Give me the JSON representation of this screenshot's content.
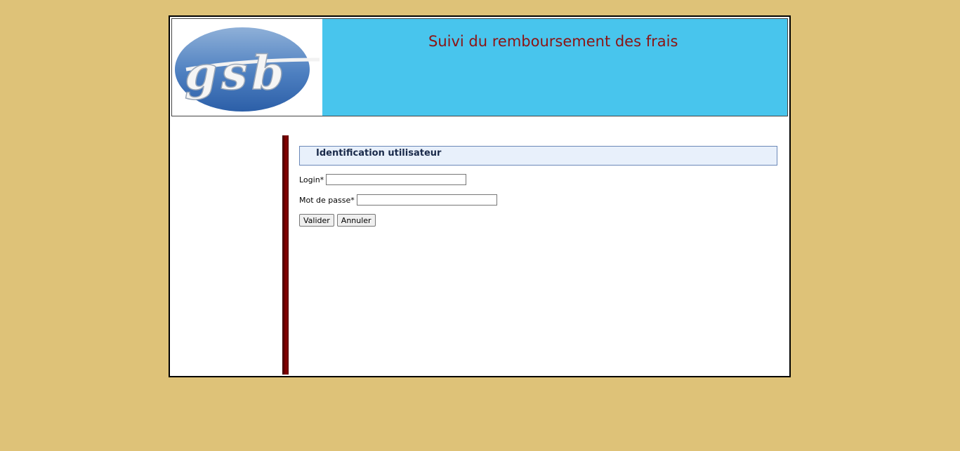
{
  "header": {
    "logo_text": "gsb",
    "title": "Suivi du remboursement des frais"
  },
  "login_form": {
    "section_title": "Identification utilisateur",
    "login_label": "Login*",
    "login_value": "",
    "password_label": "Mot de passe*",
    "password_value": "",
    "submit_label": "Valider",
    "cancel_label": "Annuler"
  },
  "colors": {
    "background": "#dec278",
    "header_bg": "#48c5ed",
    "title_color": "#8b1414",
    "menu_bar": "#8b0000"
  }
}
